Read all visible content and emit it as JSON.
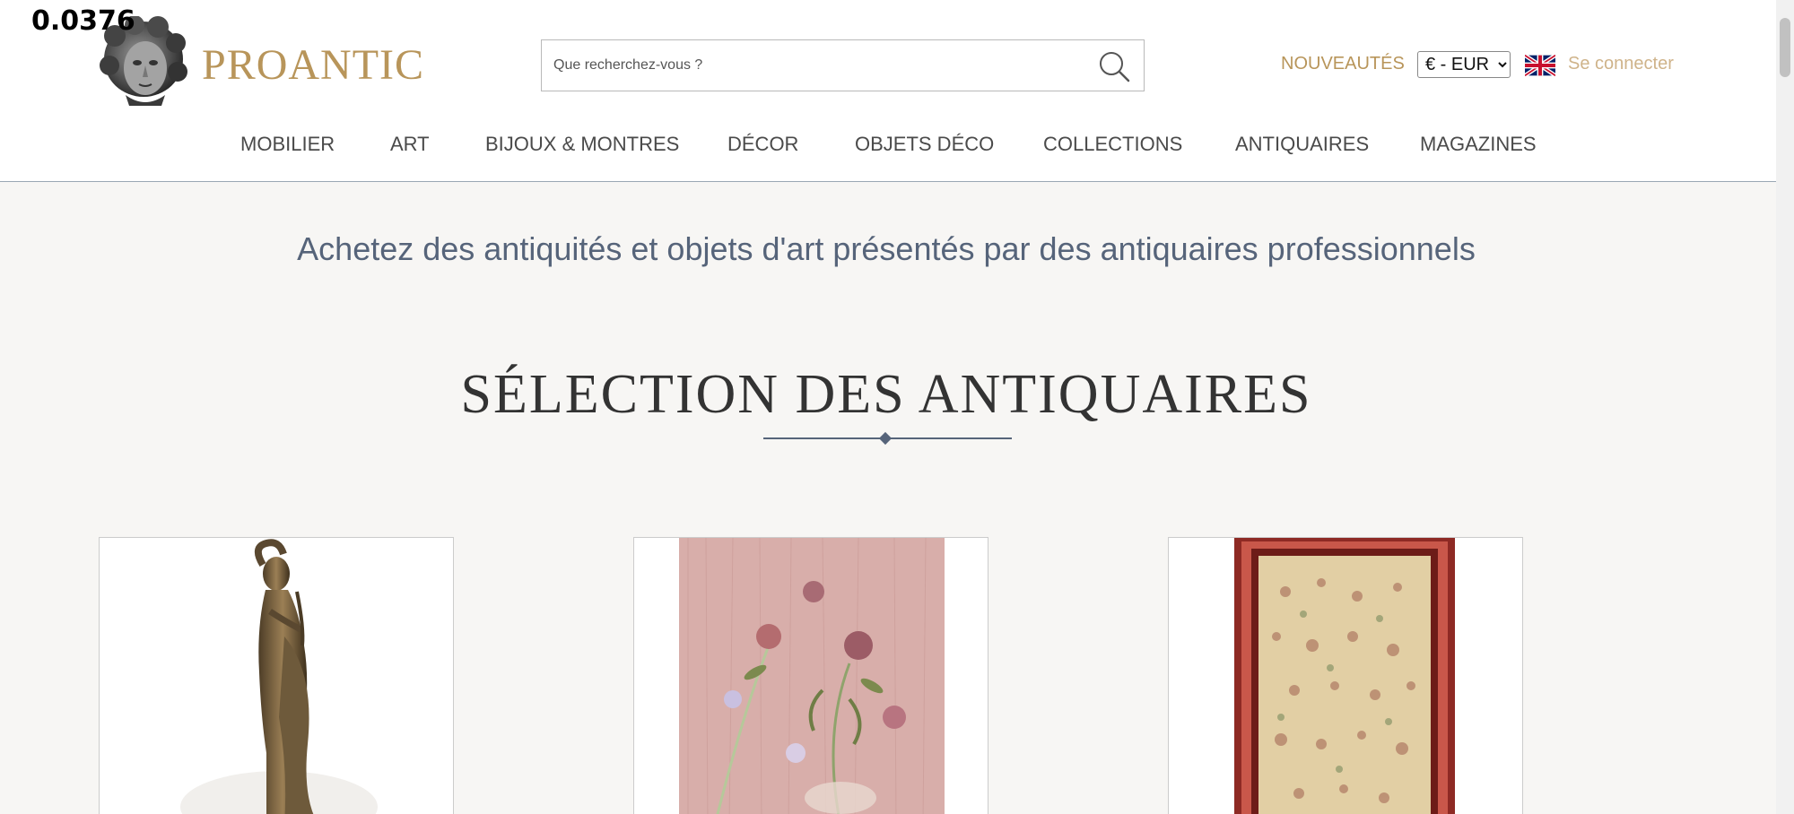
{
  "overlay": {
    "number": "0.0376"
  },
  "brand": {
    "name": "PROANTIC",
    "color": "#b8955a"
  },
  "search": {
    "placeholder": "Que recherchez-vous ?",
    "value": ""
  },
  "topbar": {
    "nouveautes": "NOUVEAUTÉS",
    "currency": "€ - EUR",
    "login": "Se connecter"
  },
  "nav": {
    "items": [
      "MOBILIER",
      "ART",
      "BIJOUX & MONTRES",
      "DÉCOR",
      "OBJETS DÉCO",
      "COLLECTIONS",
      "ANTIQUAIRES",
      "MAGAZINES"
    ]
  },
  "hero": {
    "subtitle": "Achetez des antiquités et objets d'art présentés par des antiquaires professionnels"
  },
  "section": {
    "title": "SÉLECTION DES ANTIQUAIRES"
  },
  "colors": {
    "accent": "#b8955a",
    "slate": "#56647a",
    "background": "#f7f6f4"
  }
}
